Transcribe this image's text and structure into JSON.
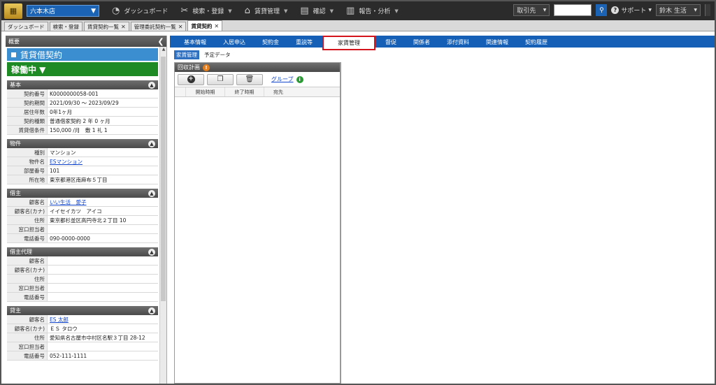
{
  "topnav": {
    "store": "六本木店",
    "items": [
      {
        "icon": "dashboard-icon",
        "glyph": "◔",
        "label": "ダッシュボード",
        "dropdown": false
      },
      {
        "icon": "tools-icon",
        "glyph": "✂",
        "label": "検索・登録",
        "dropdown": true
      },
      {
        "icon": "house-icon",
        "glyph": "⌂",
        "label": "賃貸管理",
        "dropdown": true
      },
      {
        "icon": "document-icon",
        "glyph": "▤",
        "label": "確認",
        "dropdown": true
      },
      {
        "icon": "chart-icon",
        "glyph": "▥",
        "label": "報告・分析",
        "dropdown": true
      }
    ],
    "search_category": "取引先",
    "search_value": "",
    "support_label": "サポート",
    "user_name": "鈴木 生活"
  },
  "window_tabs": [
    {
      "label": "ダッシュボード",
      "closable": false,
      "active": false
    },
    {
      "label": "検索・登録",
      "closable": false,
      "active": false
    },
    {
      "label": "賃貸契約一覧",
      "closable": true,
      "active": false
    },
    {
      "label": "管理委託契約一覧",
      "closable": true,
      "active": false
    },
    {
      "label": "賃貸契約",
      "closable": true,
      "active": true
    }
  ],
  "left": {
    "overview_label": "概要",
    "contract_title": "賃貸借契約",
    "status": "稼働中 ▼",
    "sections": [
      {
        "title": "基本",
        "rows": [
          {
            "label": "契約番号",
            "value": "K0000000058-001",
            "link": false
          },
          {
            "label": "契約期間",
            "value": "2021/09/30 ～ 2023/09/29",
            "link": false
          },
          {
            "label": "居住年数",
            "value": "0年1ヶ月",
            "link": false
          },
          {
            "label": "契約種類",
            "value": "普通借家契約 2 年 0 ヶ月",
            "link": false
          },
          {
            "label": "賃貸借条件",
            "value": "150,000 /月　敷 1 礼 1",
            "link": false
          }
        ]
      },
      {
        "title": "物件",
        "rows": [
          {
            "label": "種別",
            "value": "マンション",
            "link": false
          },
          {
            "label": "物件名",
            "value": "ESマンション",
            "link": true
          },
          {
            "label": "部屋番号",
            "value": "101",
            "link": false
          },
          {
            "label": "所在地",
            "value": "東京都港区南麻布５丁目",
            "link": false
          }
        ]
      },
      {
        "title": "借主",
        "rows": [
          {
            "label": "顧客名",
            "value": "いい生活　愛子",
            "link": true
          },
          {
            "label": "顧客名(カナ)",
            "value": "イイセイカツ　アイコ",
            "link": false
          },
          {
            "label": "住所",
            "value": "東京都杉並区高円寺北２丁目 10",
            "link": false
          },
          {
            "label": "窓口担当者",
            "value": "",
            "link": false
          },
          {
            "label": "電話番号",
            "value": "090-0000-0000",
            "link": false
          }
        ]
      },
      {
        "title": "借主代理",
        "rows": [
          {
            "label": "顧客名",
            "value": "",
            "link": false
          },
          {
            "label": "顧客名(カナ)",
            "value": "",
            "link": false
          },
          {
            "label": "住所",
            "value": "",
            "link": false
          },
          {
            "label": "窓口担当者",
            "value": "",
            "link": false
          },
          {
            "label": "電話番号",
            "value": "",
            "link": false
          }
        ]
      },
      {
        "title": "貸主",
        "rows": [
          {
            "label": "顧客名",
            "value": "ES 太郎",
            "link": true
          },
          {
            "label": "顧客名(カナ)",
            "value": "ＥＳ タロウ",
            "link": false
          },
          {
            "label": "住所",
            "value": "愛知県名古屋市中村区名駅３丁目 28-12",
            "link": false
          },
          {
            "label": "窓口担当者",
            "value": "",
            "link": false
          },
          {
            "label": "電話番号",
            "value": "052-111-1111",
            "link": false
          }
        ]
      }
    ]
  },
  "main": {
    "tabs": [
      {
        "label": "基本情報",
        "active": false
      },
      {
        "label": "入居申込",
        "active": false
      },
      {
        "label": "契約金",
        "active": false
      },
      {
        "label": "重説等",
        "active": false
      },
      {
        "label": "家賃管理",
        "active": true
      },
      {
        "label": "督促",
        "active": false
      },
      {
        "label": "関係者",
        "active": false
      },
      {
        "label": "添付資料",
        "active": false
      },
      {
        "label": "関連情報",
        "active": false
      },
      {
        "label": "契約履歴",
        "active": false
      }
    ],
    "subtabs": [
      {
        "label": "家賃管理",
        "active": true
      },
      {
        "label": "予定データ",
        "active": false
      }
    ],
    "panel_title": "回収計画",
    "group_link": "グループ",
    "columns": [
      "開始時期",
      "終了時期",
      "宛先"
    ]
  }
}
